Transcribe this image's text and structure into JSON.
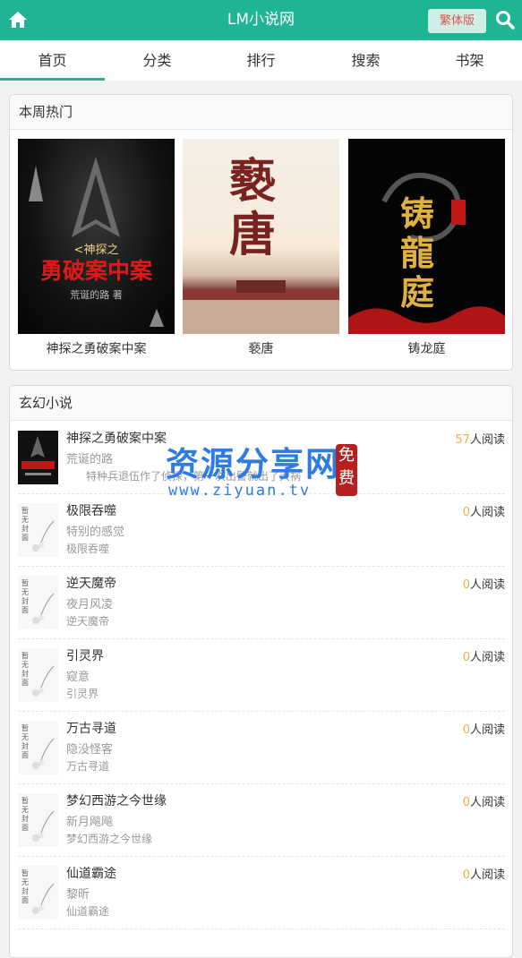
{
  "header": {
    "title": "LM小说网",
    "trad_label": "繁体版",
    "home_icon": "home-icon",
    "search_icon": "search-icon",
    "brand_color": "#1fb594"
  },
  "tabs": [
    {
      "label": "首页",
      "active": true
    },
    {
      "label": "分类",
      "active": false
    },
    {
      "label": "排行",
      "active": false
    },
    {
      "label": "搜索",
      "active": false
    },
    {
      "label": "书架",
      "active": false
    }
  ],
  "hot": {
    "title": "本周热门",
    "books": [
      {
        "name": "神探之勇破案中案",
        "cover_title": "勇破案中案",
        "cover_sub": "<神探之",
        "cover_author": "荒诞的路 著"
      },
      {
        "name": "褻唐",
        "cover_title": "褻唐"
      },
      {
        "name": "铸龙庭",
        "cover_title": "铸龍庭"
      }
    ]
  },
  "list": {
    "title": "玄幻小说",
    "books": [
      {
        "title": "神探之勇破案中案",
        "author": "荒诞的路",
        "desc": "特种兵退伍作了侦探，第一次出警就出了大祸",
        "reads": "57",
        "reads_suffix": "人阅读"
      },
      {
        "title": "极限吞噬",
        "author": "特别的感觉",
        "desc": "极限吞噬",
        "reads": "0",
        "reads_suffix": "人阅读"
      },
      {
        "title": "逆天魔帝",
        "author": "夜月风凌",
        "desc": "逆天魔帝",
        "reads": "0",
        "reads_suffix": "人阅读"
      },
      {
        "title": "引灵界",
        "author": "窥意",
        "desc": "引灵界",
        "reads": "0",
        "reads_suffix": "人阅读"
      },
      {
        "title": "万古寻道",
        "author": "隐没怪客",
        "desc": "万古寻道",
        "reads": "0",
        "reads_suffix": "人阅读"
      },
      {
        "title": "梦幻西游之今世缘",
        "author": "新月飚飚",
        "desc": "梦幻西游之今世缘",
        "reads": "0",
        "reads_suffix": "人阅读"
      },
      {
        "title": "仙道霸途",
        "author": "黎昕",
        "desc": "仙道霸途",
        "reads": "0",
        "reads_suffix": "人阅读"
      }
    ],
    "placeholder_cover_text": "暂无封面"
  },
  "watermark": {
    "main": "资源分享网",
    "url": "www.ziyuan.tv",
    "seal": "免费"
  }
}
